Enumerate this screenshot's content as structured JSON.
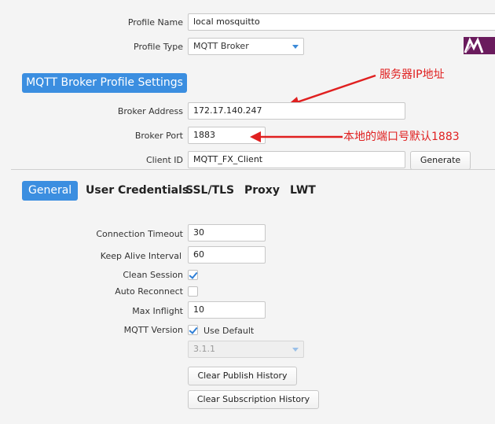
{
  "profile": {
    "name_label": "Profile Name",
    "name_value": "local mosquitto",
    "type_label": "Profile Type",
    "type_value": "MQTT Broker",
    "logo_text": "M"
  },
  "broker_section": {
    "title": "MQTT Broker Profile Settings",
    "address_label": "Broker Address",
    "address_value": "172.17.140.247",
    "port_label": "Broker Port",
    "port_value": "1883",
    "client_id_label": "Client ID",
    "client_id_value": "MQTT_FX_Client",
    "generate_label": "Generate"
  },
  "annotations": {
    "ip_note": "服务器IP地址",
    "port_note": "本地的端口号默认1883"
  },
  "tabs": [
    {
      "label": "General",
      "active": true
    },
    {
      "label": "User Credentials",
      "active": false
    },
    {
      "label": "SSL/TLS",
      "active": false
    },
    {
      "label": "Proxy",
      "active": false
    },
    {
      "label": "LWT",
      "active": false
    }
  ],
  "general": {
    "connection_timeout_label": "Connection Timeout",
    "connection_timeout_value": "30",
    "keep_alive_label": "Keep Alive Interval",
    "keep_alive_value": "60",
    "clean_session_label": "Clean Session",
    "clean_session_checked": true,
    "auto_reconnect_label": "Auto Reconnect",
    "auto_reconnect_checked": false,
    "max_inflight_label": "Max Inflight",
    "max_inflight_value": "10",
    "mqtt_version_label": "MQTT Version",
    "use_default_label": "Use Default",
    "use_default_checked": true,
    "version_value": "3.1.1",
    "clear_publish_label": "Clear Publish History",
    "clear_subscription_label": "Clear Subscription History"
  },
  "colors": {
    "accent": "#3b8ee0",
    "annotation": "#e02020",
    "logo": "#6a1b5d"
  }
}
